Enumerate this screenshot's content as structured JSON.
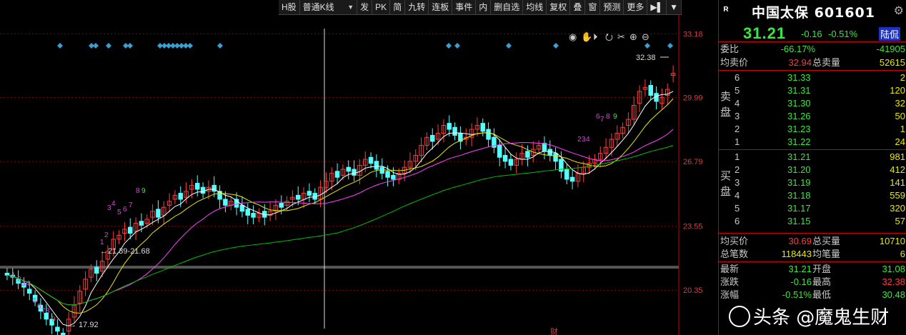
{
  "toolbar": {
    "items": [
      "H股",
      "普通K线",
      "发",
      "PK",
      "简",
      "九转",
      "连板",
      "事件",
      "内",
      "删自选",
      "均线",
      "复权",
      "叠",
      "窗",
      "预测",
      "更多"
    ],
    "kline_select": "普通K线"
  },
  "stock": {
    "name": "中国太保 601601",
    "price": "31.21",
    "change": "-0.16",
    "change_pct": "-0.51%",
    "hk_badge": "陆侃"
  },
  "summary_top": {
    "weibi_label": "委比",
    "weibi": "-66.17%",
    "weicha": "-41905",
    "avg_sell_label": "均卖价",
    "avg_sell": "32.94",
    "total_sell_label": "总卖量",
    "total_sell": "52615"
  },
  "sell_side_label": "卖盘",
  "buy_side_label": "买盘",
  "asks": [
    {
      "level": "6",
      "price": "31.33",
      "vol": "2"
    },
    {
      "level": "5",
      "price": "31.31",
      "vol": "120"
    },
    {
      "level": "4",
      "price": "31.30",
      "vol": "32"
    },
    {
      "level": "3",
      "price": "31.26",
      "vol": "50"
    },
    {
      "level": "2",
      "price": "31.23",
      "vol": "1"
    },
    {
      "level": "1",
      "price": "31.22",
      "vol": "24"
    }
  ],
  "bids": [
    {
      "level": "1",
      "price": "31.21",
      "vol": "981"
    },
    {
      "level": "2",
      "price": "31.20",
      "vol": "412"
    },
    {
      "level": "3",
      "price": "31.19",
      "vol": "141"
    },
    {
      "level": "4",
      "price": "31.18",
      "vol": "559"
    },
    {
      "level": "5",
      "price": "31.17",
      "vol": "320"
    },
    {
      "level": "6",
      "price": "31.15",
      "vol": "57"
    }
  ],
  "summary_bottom": {
    "avg_buy_label": "均买价",
    "avg_buy": "30.69",
    "total_buy_label": "总买量",
    "total_buy": "10710",
    "trades_label": "总笔数",
    "trades": "118443",
    "avg_per_trade_label": "均笔量",
    "avg_per_trade": "6",
    "last_label": "最新",
    "last": "31.21",
    "open_label": "开盘",
    "open": "31.08",
    "chg_label": "涨跌",
    "chg": "-0.16",
    "high_label": "最高",
    "high": "32.38",
    "pct_label": "涨幅",
    "pct": "-0.51%",
    "low_label": "最低",
    "low": "30.48"
  },
  "watermark": "头条 @魔鬼生财",
  "colors": {
    "up": "#ff3c3c",
    "down": "#54ffff",
    "ma5": "#ffffff",
    "ma10": "#e8e800",
    "ma20": "#ff40ff",
    "ma60": "#00c000",
    "grid": "#8b0000"
  },
  "chart_data": {
    "type": "candlestick",
    "y_ticks": [
      "33.18",
      "29.99",
      "26.79",
      "23.55",
      "20.35"
    ],
    "ylim": [
      18.5,
      33.8
    ],
    "annotations": {
      "high_label": "32.38",
      "low_label": "17.92",
      "range_label": "21.39-21.68",
      "event_marker": "财"
    },
    "countdown_labels_bottom": [
      "1",
      "2",
      "3",
      "4",
      "5",
      "6",
      "7",
      "8",
      "9"
    ],
    "countdown_labels_mid": [
      "1",
      "2",
      "3",
      "4",
      "5",
      "6",
      "7",
      "8",
      "9"
    ],
    "countdown_labels_top": [
      "2",
      "3",
      "4",
      "6",
      "7",
      "8",
      "9"
    ],
    "closes": [
      21.1,
      21.0,
      20.7,
      20.5,
      20.2,
      19.8,
      19.3,
      18.9,
      18.6,
      18.3,
      18.1,
      18.9,
      19.6,
      20.3,
      20.9,
      21.4,
      21.2,
      21.8,
      22.3,
      22.9,
      23.1,
      23.4,
      23.2,
      23.7,
      23.6,
      23.9,
      24.3,
      24.0,
      24.5,
      24.8,
      25.1,
      24.9,
      25.3,
      25.6,
      25.4,
      25.2,
      25.5,
      25.3,
      24.9,
      24.6,
      24.8,
      24.5,
      24.3,
      24.1,
      24.0,
      24.2,
      24.0,
      24.3,
      24.6,
      24.5,
      24.8,
      25.0,
      24.9,
      25.2,
      25.1,
      24.9,
      25.5,
      25.8,
      26.2,
      26.0,
      26.4,
      26.3,
      26.1,
      26.6,
      26.9,
      26.7,
      26.4,
      26.2,
      26.0,
      25.9,
      26.2,
      26.5,
      26.8,
      27.1,
      27.6,
      28.0,
      27.8,
      28.2,
      28.6,
      28.4,
      28.1,
      27.8,
      28.0,
      28.4,
      28.6,
      28.3,
      27.9,
      27.5,
      27.0,
      26.8,
      26.6,
      26.9,
      27.2,
      27.0,
      27.4,
      27.6,
      27.3,
      27.1,
      26.8,
      26.3,
      25.9,
      25.8,
      26.2,
      26.5,
      26.7,
      26.9,
      27.2,
      27.5,
      27.9,
      28.2,
      28.5,
      28.9,
      29.6,
      30.3,
      30.5,
      30.1,
      29.8,
      30.0,
      30.4,
      31.2
    ],
    "opens": [
      21.2,
      21.1,
      20.9,
      20.7,
      20.4,
      20.1,
      19.6,
      19.2,
      18.9,
      18.5,
      18.2,
      18.3,
      19.0,
      19.7,
      20.4,
      21.0,
      21.5,
      21.3,
      21.9,
      22.4,
      22.9,
      23.2,
      23.5,
      23.3,
      23.8,
      23.7,
      24.0,
      24.4,
      24.1,
      24.6,
      24.9,
      25.2,
      25.0,
      25.4,
      25.7,
      25.5,
      25.3,
      25.6,
      25.3,
      24.9,
      24.6,
      24.9,
      24.6,
      24.4,
      24.2,
      24.0,
      24.3,
      24.1,
      24.3,
      24.7,
      24.6,
      24.9,
      25.1,
      24.9,
      25.3,
      25.2,
      24.9,
      25.5,
      25.8,
      26.3,
      26.1,
      26.5,
      26.4,
      26.1,
      26.6,
      27.0,
      26.8,
      26.5,
      26.3,
      26.1,
      25.9,
      26.2,
      26.5,
      26.8,
      27.1,
      27.6,
      28.1,
      27.9,
      28.2,
      28.7,
      28.5,
      28.2,
      27.9,
      28.0,
      28.4,
      28.7,
      28.4,
      28.0,
      27.6,
      27.1,
      26.9,
      26.6,
      26.9,
      27.3,
      27.1,
      27.4,
      27.7,
      27.4,
      27.2,
      26.9,
      26.4,
      26.0,
      25.8,
      26.2,
      26.5,
      26.7,
      26.9,
      27.2,
      27.5,
      27.9,
      28.2,
      28.6,
      28.9,
      29.7,
      30.4,
      30.6,
      30.2,
      29.7,
      30.1,
      31.1
    ]
  }
}
